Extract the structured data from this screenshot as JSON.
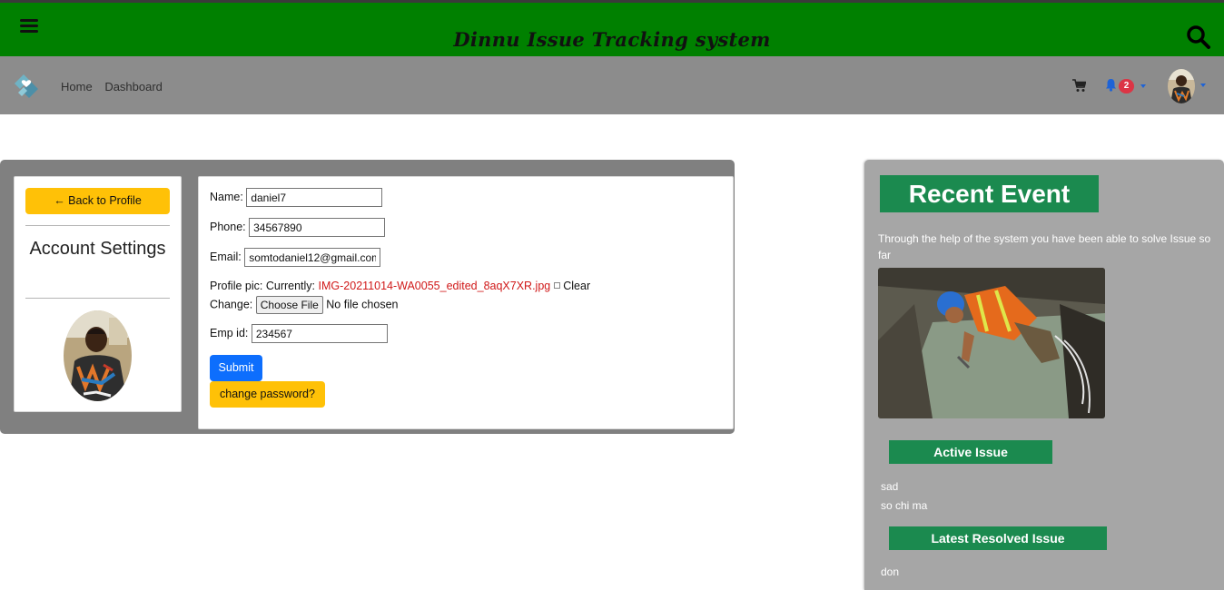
{
  "header": {
    "title": "Dinnu Issue Tracking system",
    "menu_icon": "hamburger-menu-icon",
    "search_icon": "search-icon",
    "bg_color": "#008000"
  },
  "nav": {
    "links": [
      "Home",
      "Dashboard"
    ],
    "cart_icon": "cart-icon",
    "bell_icon": "bell-icon",
    "notification_count": "2",
    "badge_color": "#dc3545",
    "bg_color": "#8c8c8c"
  },
  "profile_card": {
    "back_label": "← Back to Profile",
    "title": "Account Settings"
  },
  "form": {
    "name_label": "Name:",
    "name_value": "daniel7",
    "phone_label": "Phone:",
    "phone_value": "34567890",
    "email_label": "Email:",
    "email_value": "somtodaniel12@gmail.com",
    "pic_label": "Profile pic:",
    "currently_label": "Currently:",
    "current_file": "IMG-20211014-WA0055_edited_8aqX7XR.jpg",
    "clear_label": "Clear",
    "change_label": "Change:",
    "choose_file_label": "Choose File",
    "no_file_text": "No file chosen",
    "empid_label": "Emp id:",
    "empid_value": "234567",
    "submit_label": "Submit",
    "change_password_label": "change password?"
  },
  "events": {
    "title": "Recent Event",
    "description": "Through the help of the system you have been able to solve Issue so far",
    "active_label": "Active Issue",
    "active_issues": [
      "sad",
      "so chi ma"
    ],
    "resolved_label": "Latest Resolved Issue",
    "resolved_issues": [
      "don"
    ],
    "accent_color": "#1b8a4f"
  }
}
